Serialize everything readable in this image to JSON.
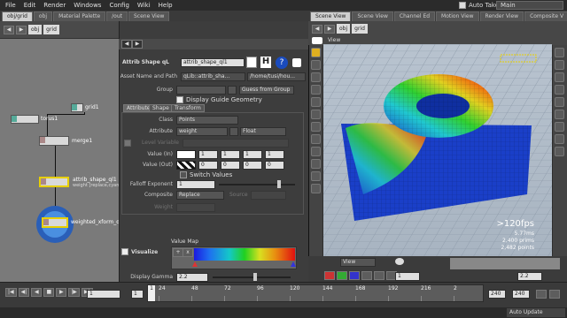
{
  "menu": [
    "File",
    "Edit",
    "Render",
    "Windows",
    "Config",
    "Wiki",
    "Help"
  ],
  "autotakes_label": "Auto Takes",
  "desktop": "Main",
  "left_tabs": [
    "obj/grid",
    "obj",
    "Material Palette",
    "/out",
    "Scene View"
  ],
  "right_tabs": [
    "Scene View",
    "Scene View",
    "Channel Ed",
    "Motion View",
    "Render View",
    "Composite V"
  ],
  "network": {
    "path_root": "obj",
    "path_node": "grid",
    "nodes": [
      {
        "name": "grid1",
        "label": "grid1"
      },
      {
        "name": "torus1",
        "label": "torus1"
      },
      {
        "name": "merge1",
        "label": "merge1"
      },
      {
        "name": "attrib_shape_ql1",
        "label": "attrib_shape_ql1",
        "sub": "weight [replace,cyan"
      },
      {
        "name": "weighted_xform_ql1",
        "label": "weighted_xform_ql1"
      }
    ]
  },
  "parms": {
    "header_type": "Attrib Shape qL",
    "header_name": "attrib_shape_ql1",
    "asset_label": "Asset Name and Path",
    "asset_name": "qLib::attrib_sha...",
    "asset_path": "/home/tusi/hou...",
    "group_label": "Group",
    "group_value": "",
    "group_menu": "Guess from Group",
    "display_guide": "Display Guide Geometry",
    "tabs": [
      "Attribute",
      "Shape",
      "Transform"
    ],
    "class_label": "Class",
    "class_value": "Points",
    "attribute_label": "Attribute",
    "attribute_value": "weight",
    "attribute_type": "Float",
    "level_label": "Level Variable",
    "value_in_label": "Value (In)",
    "value_in": [
      "1",
      "1",
      "1",
      "1"
    ],
    "value_out_label": "Value (Out)",
    "value_out": [
      "0",
      "0",
      "0",
      "0"
    ],
    "switch_values": "Switch Values",
    "falloff_label": "Falloff Exponent",
    "falloff_value": "1",
    "composite_label": "Composite",
    "composite_value": "Replace",
    "source_label": "Source",
    "weight_label": "Weight",
    "visualize_label": "Visualize",
    "value_map_label": "Value Map",
    "display_gamma_label": "Display Gamma",
    "display_gamma_value": "2.2"
  },
  "viewer": {
    "title": "View",
    "path_root": "obj",
    "path_node": "grid",
    "fps": ">120fps",
    "time": "5.77ms",
    "prims": "2,400  prims",
    "points": "2,482  points",
    "view_menu": "View",
    "bottom_values": [
      "1",
      "2.2"
    ]
  },
  "timeline": {
    "frame": "1",
    "start": "1",
    "end": "240",
    "end2": "240",
    "ticks": [
      "24",
      "48",
      "72",
      "96",
      "120",
      "144",
      "168",
      "192",
      "216",
      "2"
    ],
    "first": "1"
  },
  "status": {
    "auto_update": "Auto Update"
  },
  "colors": {
    "accent_yellow": "#e8d000",
    "node_blue": "#4a8fe0",
    "grid_blue": "#1a3fc8"
  }
}
